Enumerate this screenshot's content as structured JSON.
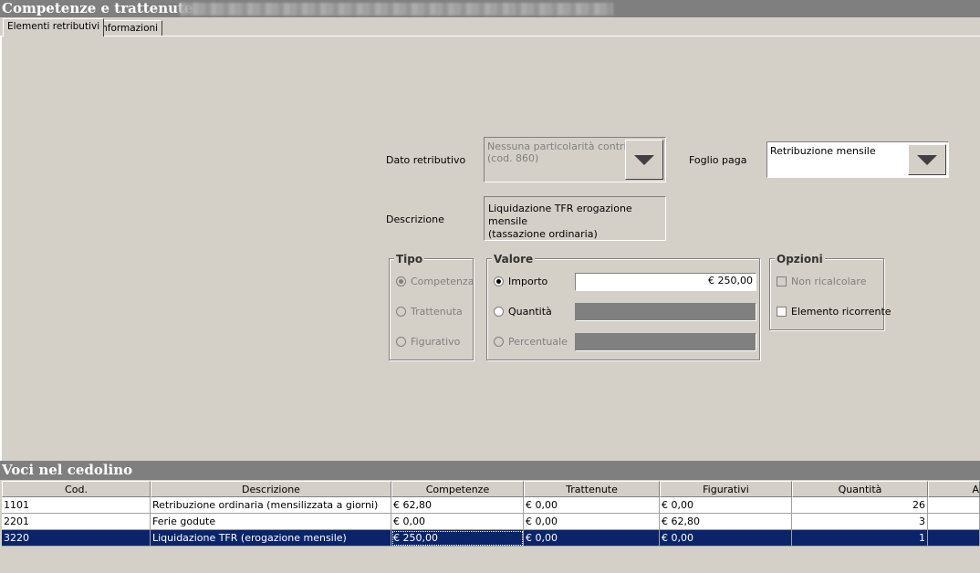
{
  "window": {
    "title": "Competenze e trattenute"
  },
  "tabs": [
    {
      "label": "Elementi retributivi",
      "active": true
    },
    {
      "label": "Informazioni",
      "active": false
    }
  ],
  "form": {
    "dato_retributivo_label": "Dato retributivo",
    "dato_retributivo_value_line1": "Nessuna particolarità contribut",
    "dato_retributivo_value_line2": "(cod. 860)",
    "foglio_paga_label": "Foglio paga",
    "foglio_paga_value": "Retribuzione mensile",
    "descrizione_label": "Descrizione",
    "descrizione_line1": "Liquidazione TFR erogazione mensile",
    "descrizione_line2": "(tassazione ordinaria)"
  },
  "tipo": {
    "title": "Tipo",
    "options": [
      "Competenza",
      "Trattenuta",
      "Figurativo"
    ],
    "selected": "Competenza"
  },
  "valore": {
    "title": "Valore",
    "importo_label": "Importo",
    "importo_value": "€ 250,00",
    "quantita_label": "Quantità",
    "percentuale_label": "Percentuale",
    "selected": "Importo"
  },
  "opzioni": {
    "title": "Opzioni",
    "non_ricalcolare_label": "Non ricalcolare",
    "non_ricalcolare_checked": false,
    "elemento_ricorrente_label": "Elemento ricorrente",
    "elemento_ricorrente_checked": false
  },
  "voci": {
    "title": "Voci nel cedolino",
    "columns": [
      "Cod.",
      "Descrizione",
      "Competenze",
      "Trattenute",
      "Figurativi",
      "Quantità",
      "A"
    ],
    "rows": [
      [
        "1101",
        "Retribuzione ordinaria (mensilizzata a giorni)",
        "€ 62,80",
        "€ 0,00",
        "€ 0,00",
        "26"
      ],
      [
        "2201",
        "Ferie godute",
        "€ 0,00",
        "€ 0,00",
        "€ 62,80",
        "3"
      ],
      [
        "3220",
        "Liquidazione TFR (erogazione mensile)",
        "€ 250,00",
        "€ 0,00",
        "€ 0,00",
        "1"
      ]
    ],
    "selected_row": 2
  },
  "colors": {
    "selection": "#0a246a",
    "window_bg": "#d4d0c8",
    "titlebar": "#7f7f7f"
  }
}
